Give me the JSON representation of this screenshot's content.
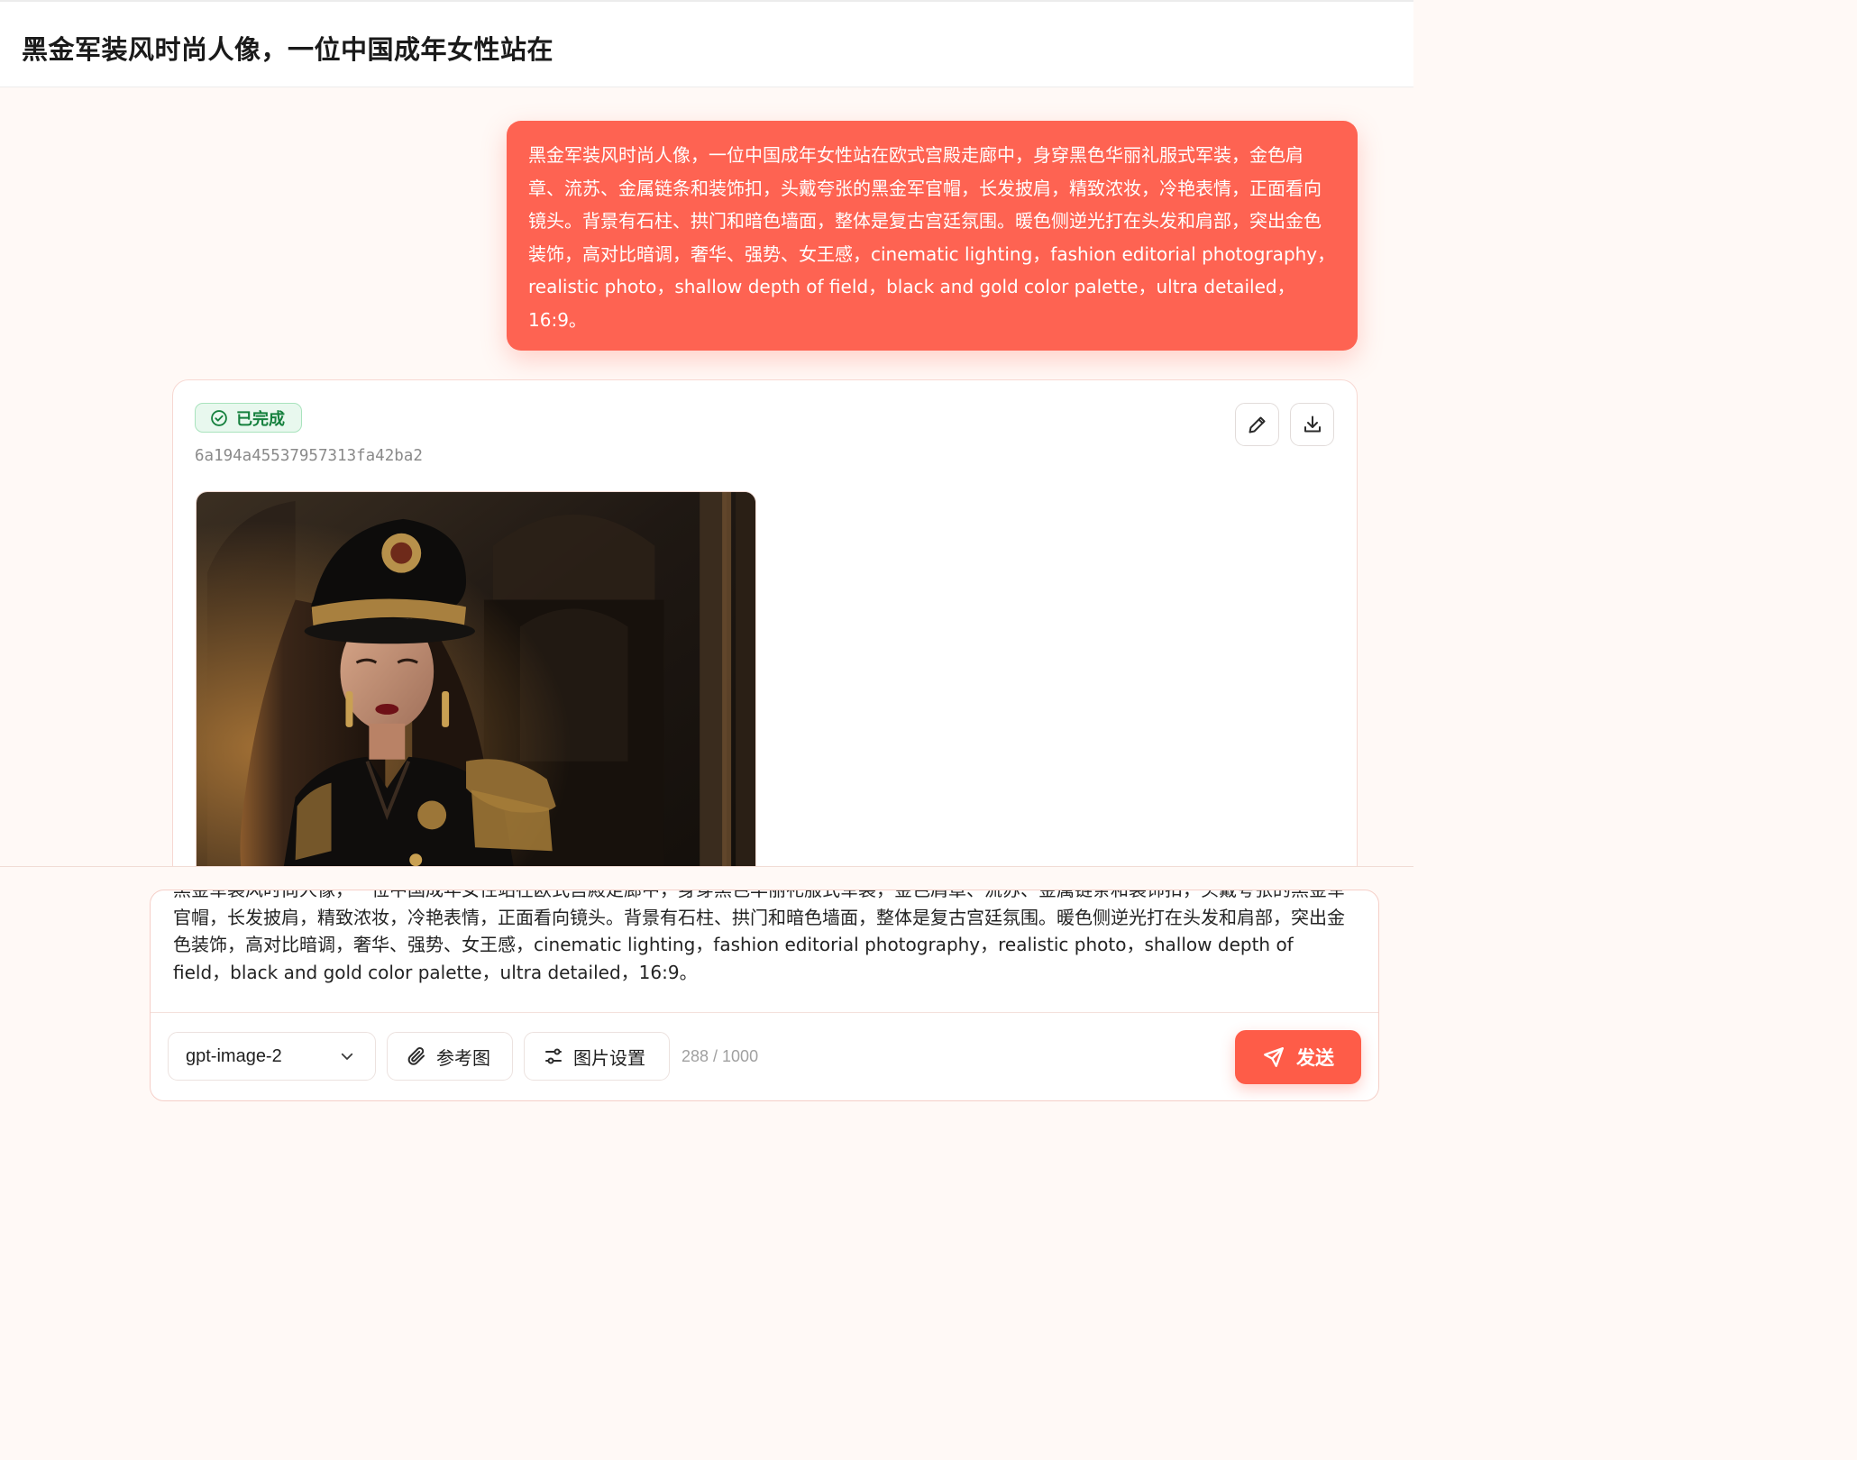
{
  "header": {
    "title": "黑金军装风时尚人像，一位中国成年女性站在"
  },
  "conversation": {
    "user_prompt": "黑金军装风时尚人像，一位中国成年女性站在欧式宫殿走廊中，身穿黑色华丽礼服式军装，金色肩章、流苏、金属链条和装饰扣，头戴夸张的黑金军官帽，长发披肩，精致浓妆，冷艳表情，正面看向镜头。背景有石柱、拱门和暗色墙面，整体是复古宫廷氛围。暖色侧逆光打在头发和肩部，突出金色装饰，高对比暗调，奢华、强势、女王感，cinematic lighting，fashion editorial photography，realistic photo，shallow depth of field，black and gold color palette，ultra detailed，16:9。"
  },
  "result": {
    "status": "已完成",
    "status_color": "#15803d",
    "task_id": "6a194a45537957313fa42ba2",
    "edit_icon": "pencil-icon",
    "download_icon": "download-icon"
  },
  "composer": {
    "prompt_value": "黑金军装风时尚人像，一位中国成年女性站在欧式宫殿走廊中，身穿黑色华丽礼服式军装，金色肩章、流苏、金属链条和装饰扣，头戴夸张的黑金军官帽，长发披肩，精致浓妆，冷艳表情，正面看向镜头。背景有石柱、拱门和暗色墙面，整体是复古宫廷氛围。暖色侧逆光打在头发和肩部，突出金色装饰，高对比暗调，奢华、强势、女王感，cinematic lighting，fashion editorial photography，realistic photo，shallow depth of field，black and gold color palette，ultra detailed，16:9。",
    "model": "gpt-image-2",
    "reference_label": "参考图",
    "settings_label": "图片设置",
    "char_count": "288 / 1000",
    "send_label": "发送"
  },
  "colors": {
    "accent": "#fe6352",
    "send_button": "#fe5c48",
    "page_background": "#fff9f6",
    "success": "#15803d"
  }
}
